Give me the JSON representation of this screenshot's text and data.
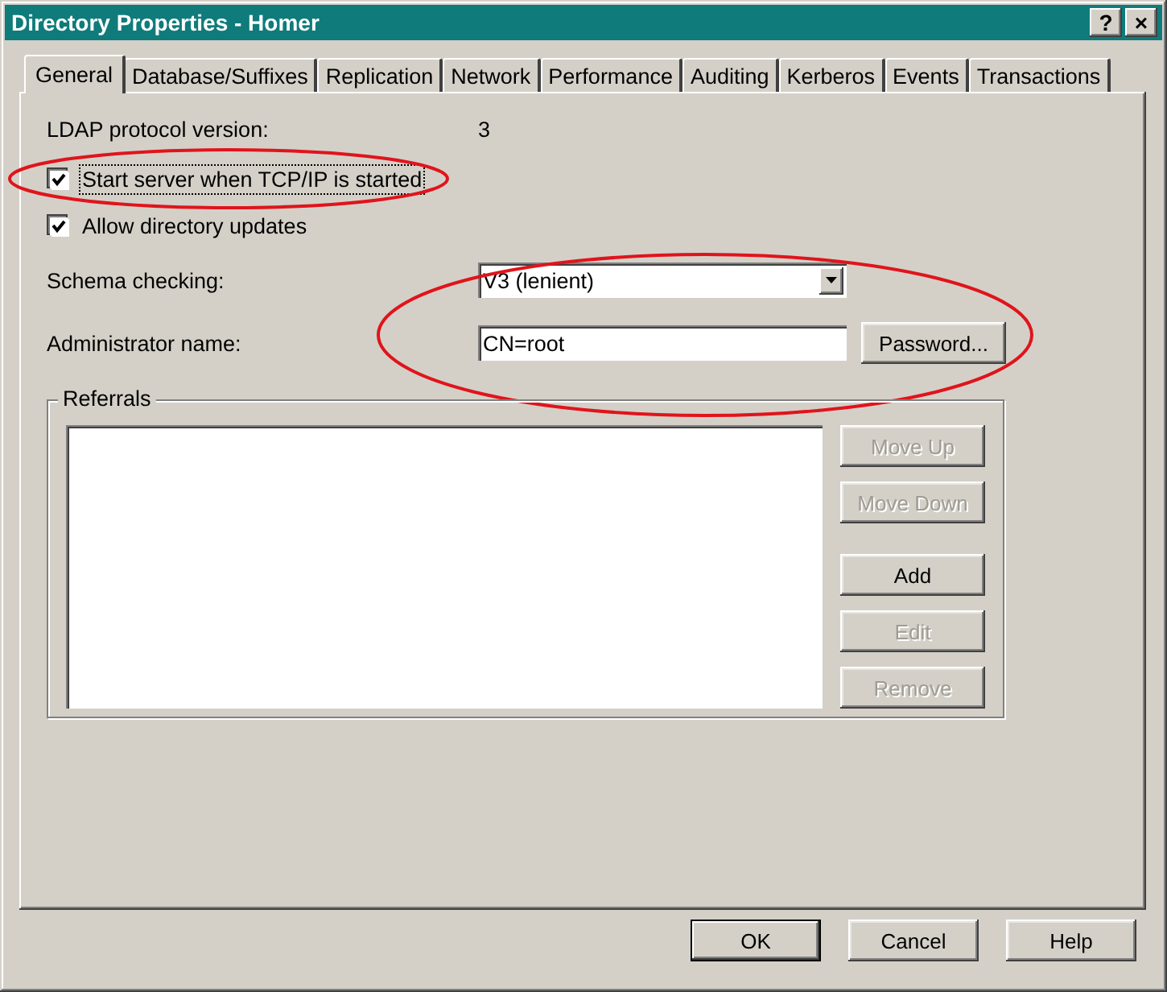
{
  "window": {
    "title": "Directory Properties - Homer",
    "title_buttons": [
      "?",
      "×"
    ]
  },
  "tabs": [
    {
      "label": "General",
      "selected": true
    },
    {
      "label": "Database/Suffixes",
      "selected": false
    },
    {
      "label": "Replication",
      "selected": false
    },
    {
      "label": "Network",
      "selected": false
    },
    {
      "label": "Performance",
      "selected": false
    },
    {
      "label": "Auditing",
      "selected": false
    },
    {
      "label": "Kerberos",
      "selected": false
    },
    {
      "label": "Events",
      "selected": false
    },
    {
      "label": "Transactions",
      "selected": false
    }
  ],
  "protocol": {
    "label": "LDAP protocol version:",
    "value": "3"
  },
  "checkboxes": [
    {
      "label": "Start server when TCP/IP is started",
      "checked": true,
      "circled": true
    },
    {
      "label": "Allow directory updates",
      "checked": true,
      "circled": false
    }
  ],
  "schema": {
    "label": "Schema checking:",
    "value": "V3 (lenient)"
  },
  "admin": {
    "label": "Administrator name:",
    "value": "CN=root",
    "button": "Password...",
    "circled": true
  },
  "referrals": {
    "title": "Referrals",
    "buttons": [
      {
        "label": "Move Up",
        "disabled": true
      },
      {
        "label": "Move Down",
        "disabled": true
      },
      {
        "label": "Add",
        "disabled": false
      },
      {
        "label": "Edit",
        "disabled": true
      },
      {
        "label": "Remove",
        "disabled": true
      }
    ]
  },
  "footer_buttons": [
    {
      "label": "OK",
      "default": true
    },
    {
      "label": "Cancel",
      "default": false
    },
    {
      "label": "Help",
      "default": false
    }
  ]
}
